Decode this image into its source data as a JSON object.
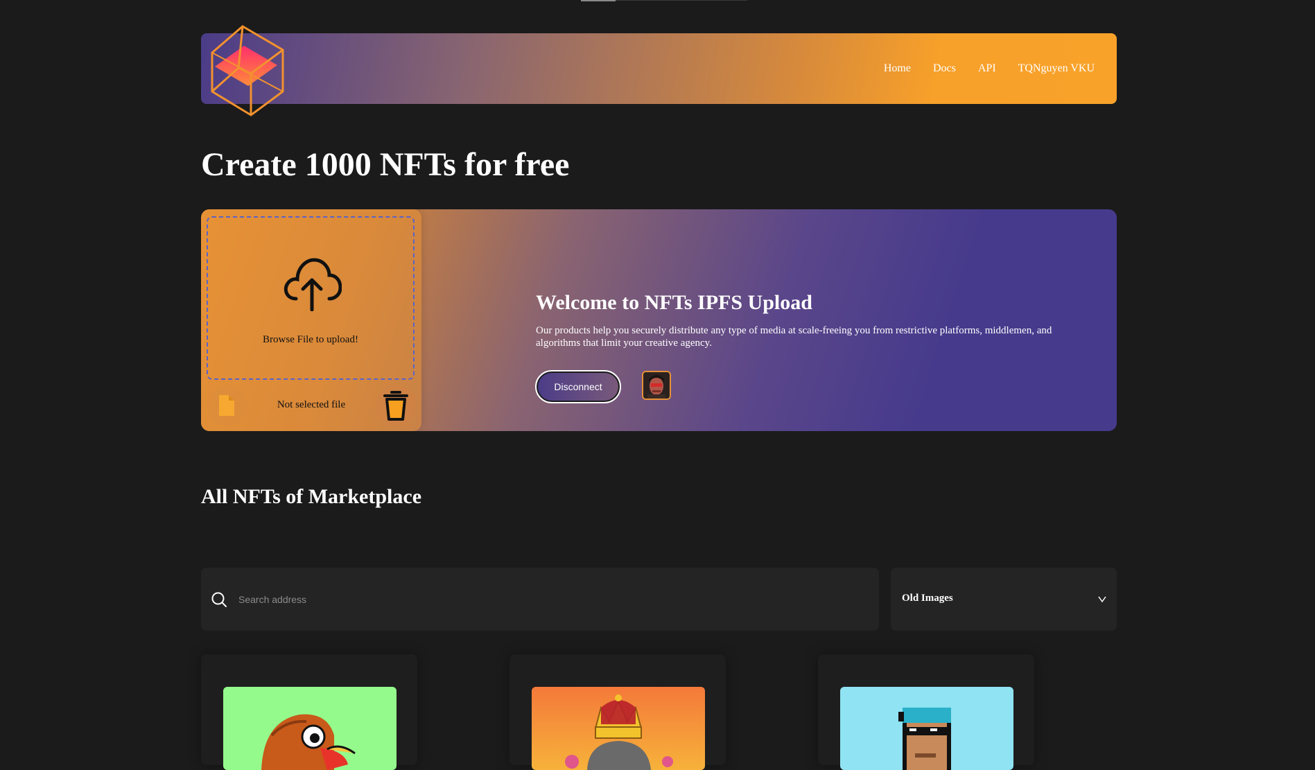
{
  "nav": {
    "items": [
      "Home",
      "Docs",
      "API",
      "TQNguyen VKU"
    ]
  },
  "page_title": "Create 1000 NFTs for free",
  "upload": {
    "browse_label": "Browse File to upload!",
    "file_status": "Not selected file"
  },
  "hero": {
    "title": "Welcome to NFTs IPFS Upload",
    "description": "Our products help you securely distribute any type of media at scale-freeing you from restrictive platforms, middlemen, and algorithms that limit your creative agency.",
    "disconnect_label": "Disconnect"
  },
  "marketplace": {
    "title": "All NFTs of Marketplace",
    "search_placeholder": "Search address",
    "sort_selected": "Old Images"
  },
  "colors": {
    "background": "#1b1b1b",
    "accent_orange": "#f8a22a",
    "accent_purple": "#463a8c",
    "panel": "#242424"
  },
  "icons": [
    "logo-cube-icon",
    "upload-cloud-icon",
    "file-icon",
    "trash-icon",
    "search-icon",
    "chevron-down-icon"
  ]
}
